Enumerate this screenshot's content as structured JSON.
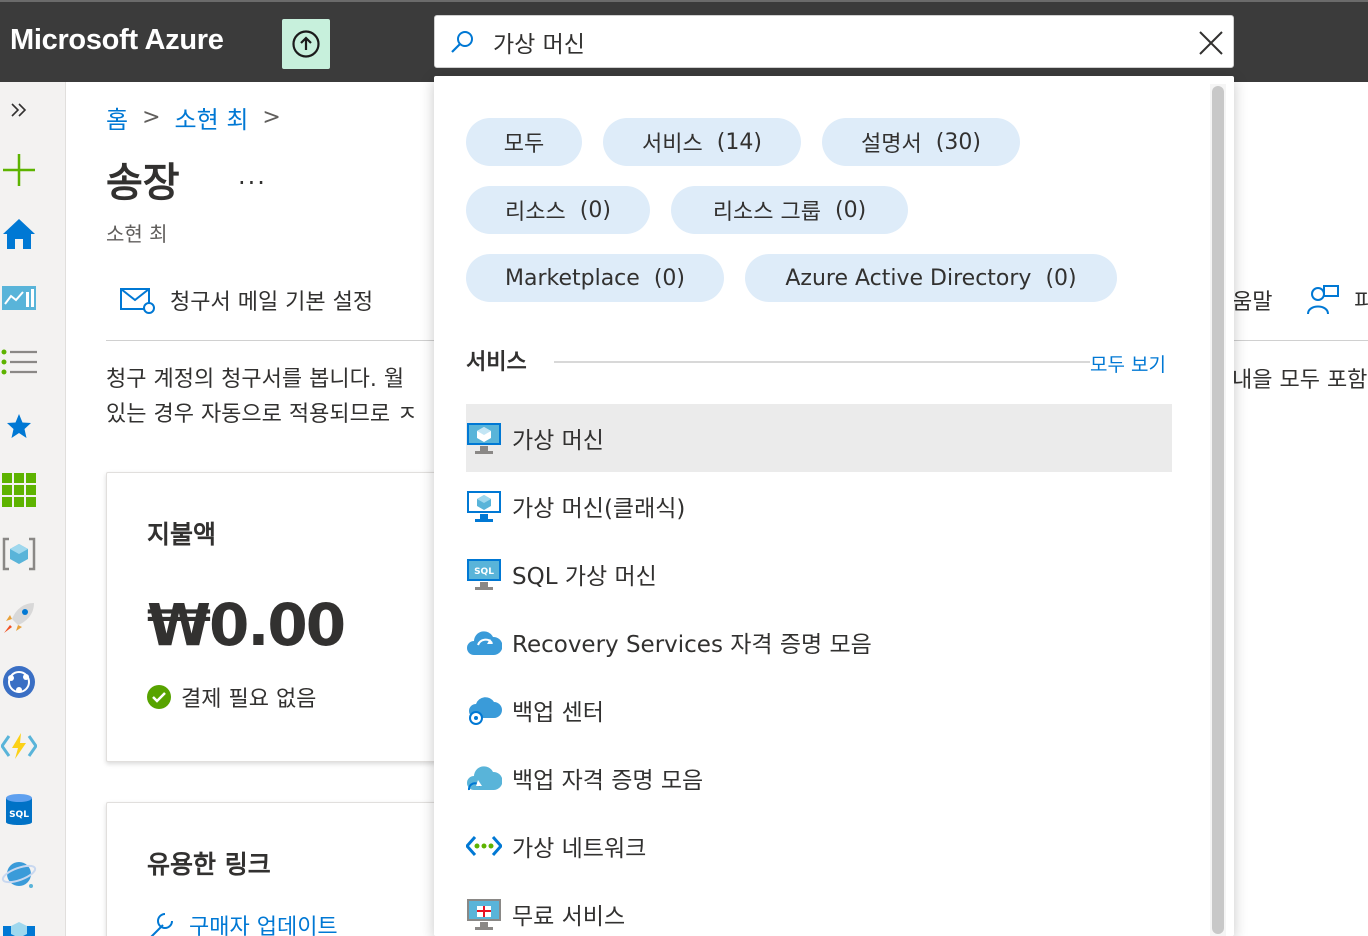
{
  "brand": "Microsoft Azure",
  "search": {
    "value": "가상 머신"
  },
  "breadcrumb": {
    "home": "홈",
    "user": "소현 최"
  },
  "page": {
    "title": "송장",
    "more": "...",
    "subtitle": "소현 최"
  },
  "toolbar": {
    "email_settings": "청구서 메일 기본 설정",
    "help_fragment": "움말",
    "feedback_fragment": "피"
  },
  "description": {
    "line1": "청구 계정의 청구서를 봅니다. 월",
    "line2": "있는 경우 자동으로 적용되므로 ㅈ",
    "right": "내을 모두 포함"
  },
  "card_payment": {
    "title": "지불액",
    "amount": "₩0.00",
    "status": "결제 필요 없음"
  },
  "card_links": {
    "title": "유용한 링크",
    "link1": "구매자 업데이트"
  },
  "filters": [
    {
      "label": "모두"
    },
    {
      "label": "서비스",
      "count": "(14)"
    },
    {
      "label": "설명서",
      "count": "(30)"
    },
    {
      "label": "리소스",
      "count": "(0)"
    },
    {
      "label": "리소스 그룹",
      "count": "(0)"
    },
    {
      "label": "Marketplace",
      "count": "(0)"
    },
    {
      "label": "Azure Active Directory",
      "count": "(0)"
    }
  ],
  "services_section": {
    "label": "서비스",
    "see_all": "모두 보기"
  },
  "results": [
    {
      "label": "가상 머신",
      "icon": "vm-icon"
    },
    {
      "label": "가상 머신(클래식)",
      "icon": "vm-classic-icon"
    },
    {
      "label": "SQL 가상 머신",
      "icon": "sql-vm-icon"
    },
    {
      "label": "Recovery Services 자격 증명 모음",
      "icon": "recovery-vault-icon"
    },
    {
      "label": "백업 센터",
      "icon": "backup-center-icon"
    },
    {
      "label": "백업 자격 증명 모음",
      "icon": "backup-vault-icon"
    },
    {
      "label": "가상 네트워크",
      "icon": "vnet-icon"
    },
    {
      "label": "무료 서비스",
      "icon": "free-services-icon"
    }
  ],
  "colors": {
    "accent": "#0078d4",
    "topbar": "#3b3b3b",
    "chip": "#deecf9"
  }
}
